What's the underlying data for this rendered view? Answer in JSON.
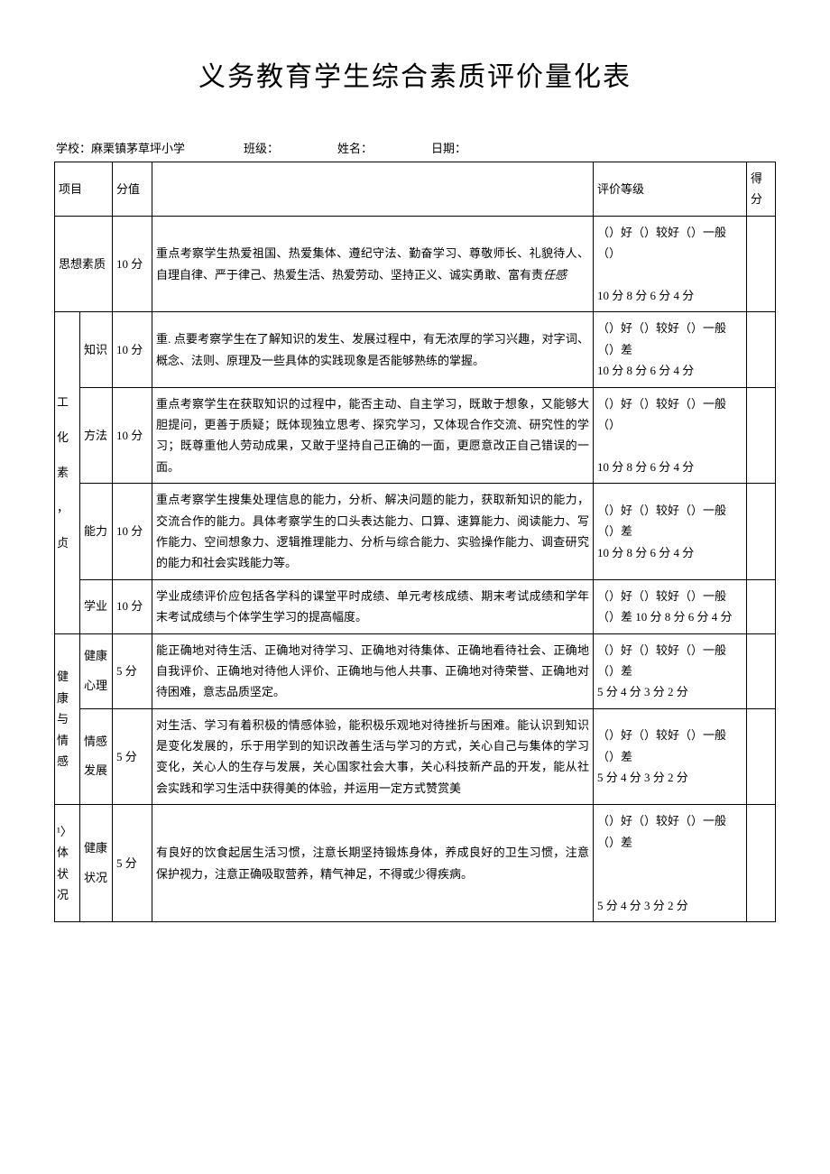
{
  "title": "义务教育学生综合素质评价量化表",
  "meta": {
    "school_label": "学校：麻栗镇茅草坪小学",
    "class_label": "班级：",
    "name_label": "姓名：",
    "date_label": "日期："
  },
  "headers": {
    "project": "项目",
    "score": "分值",
    "rating": "评价等级",
    "result": "得分"
  },
  "rows": {
    "r1": {
      "cat": "思想素质",
      "score": "10 分",
      "desc_prefix": "重点考察学生热爱祖国、热爱集体、遵纪守法、勤奋学习、尊敬师长、礼貌待人、自理自律、严于律己、热爱生活、热爱劳动、坚持正义、诚实勇敢、富有责",
      "desc_italic": "任感",
      "rating": "（）好（）较好（）一般（）\n\n10 分 8 分 6 分 4 分"
    },
    "group_wh": {
      "cat": "工\n化\n素\n，贞",
      "r2": {
        "sub": "知识",
        "score": "10 分",
        "desc": "重. 点要考察学生在了解知识的发生、发展过程中，有无浓厚的学习兴趣，对字词、概念、法则、原理及一些具体的实践现象是否能够熟练的掌握。",
        "rating": "（）好（）较好（）一般（）差\n10 分 8 分 6 分 4 分"
      },
      "r3": {
        "sub": "方法",
        "score": "10 分",
        "desc": "重点考察学生在获取知识的过程中，能否主动、自主学习，既敢于想象，又能够大胆提问，更善于质疑；既体现独立思考、探究学习，又体现合作交流、研究性的学习；既尊重他人劳动成果，又敢于坚持自己正确的一面，更愿意改正自己错误的一面。",
        "rating": "（）好（）较好（）一般（）\n\n10 分 8 分 6 分 4 分"
      },
      "r4": {
        "sub": "能力",
        "score": "10 分",
        "desc": "重点考察学生搜集处理信息的能力，分析、解决问题的能力，获取新知识的能力，交流合作的能力。具体考察学生的口头表达能力、口算、速算能力、阅读能力、写作能力、空间想象力、逻辑推理能力、分析与综合能力、实验操作能力、调查研究的能力和社会实践能力等。",
        "rating": "（）好（）较好（）一般（）差\n10 分 8 分 6 分 4 分"
      },
      "r5": {
        "sub": "学业",
        "score": "10 分",
        "desc": "学业成绩评价应包括各学科的课堂平时成绩、单元考核成绩、期末考试成绩和学年末考试成绩与个体学生学习的提高幅度。",
        "rating": "（）好（）较好（）一般（）差 10 分 8 分 6 分 4 分"
      }
    },
    "group_jk": {
      "cat": "健康与情感",
      "r6": {
        "sub": "健康\n心理",
        "score": "5 分",
        "desc": "能正确地对待生活、正确地对待学习、正确地对待集体、正确地看待社会、正确地自我评价、正确地对待他人评价、正确地与他人共事、正确地对待荣誉、正确地对待困难，意志品质坚定。",
        "rating": "（）好（）较好（）一般（）差\n5 分 4 分 3 分 2 分"
      },
      "r7": {
        "sub": "情感\n发展",
        "score": "5 分",
        "desc": "对生活、学习有着积极的情感体验，能积极乐观地对待挫折与困难。能认识到知识是变化发展的，乐于用学到的知识改善生活与学习的方式，关心自己与集体的学习变化，关心人的生存与发展，关心国家社会大事，关心科技新产品的开发，能从社会实践和学习生活中获得美的体验，并运用一定方式赞赏美",
        "rating": "（）好（）较好（）一般（）差\n5 分 4 分 3 分 2 分"
      }
    },
    "group_st": {
      "cat": "¹〉体状况",
      "r8": {
        "sub": "健康\n状况",
        "score": "5 分",
        "desc": "有良好的饮食起居生活习惯，注意长期坚持锻炼身体，养成良好的卫生习惯，注意保护视力，注意正确吸取营养，精气神足，不得或少得疾病。",
        "rating": "（）好（）较好（）一般（）差\n\n\n5 分 4 分 3 分 2 分"
      }
    }
  }
}
